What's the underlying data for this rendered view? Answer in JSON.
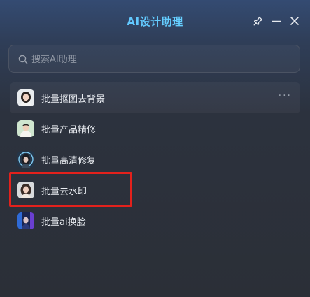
{
  "window": {
    "title": "AI设计助理",
    "pin_icon": "pin-icon",
    "minimize_icon": "minimize-icon",
    "close_icon": "close-icon"
  },
  "search": {
    "placeholder": "搜索AI助理",
    "value": "",
    "icon": "search-icon"
  },
  "items": [
    {
      "label": "批量抠图去背景",
      "icon": "avatar-woman-portrait",
      "hover": true,
      "more": "···"
    },
    {
      "label": "批量产品精修",
      "icon": "avatar-man-portrait"
    },
    {
      "label": "批量高清修复",
      "icon": "avatar-glowing-portrait"
    },
    {
      "label": "批量去水印",
      "icon": "avatar-woman-portrait-2",
      "annotated": true
    },
    {
      "label": "批量ai换脸",
      "icon": "avatar-blue-scene"
    }
  ],
  "colors": {
    "title_gradient_start": "#58b7ff",
    "title_gradient_end": "#6fe0ff",
    "annotation_red": "#e3211c",
    "text_primary": "#e9ecf1",
    "placeholder": "#8f96a3"
  }
}
